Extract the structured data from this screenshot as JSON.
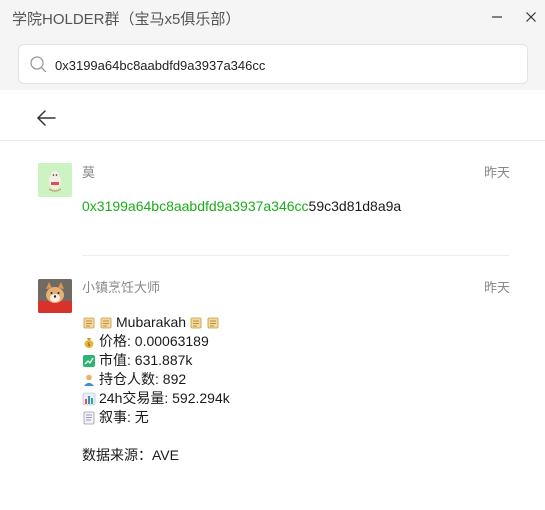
{
  "window": {
    "title": "学院HOLDER群（宝马x5俱乐部）",
    "min_icon": "minimize-icon",
    "close_icon": "close-icon"
  },
  "search": {
    "value": "0x3199a64bc8aabdfd9a3937a346cc",
    "icon": "search-icon"
  },
  "nav": {
    "back_icon": "back-arrow-icon"
  },
  "messages": [
    {
      "sender": "莫",
      "time": "昨天",
      "text_highlight": "0x3199a64bc8aabdfd9a3937a346cc",
      "text_rest": "59c3d81d8a9a",
      "highlight_color": "#1aad19"
    },
    {
      "sender": "小镇烹饪大师",
      "time": "昨天",
      "lines": {
        "name": "Mubarakah",
        "price": "价格: 0.00063189",
        "mcap": "市值: 631.887k",
        "holders": "持仓人数: 892",
        "volume": "24h交易量: 592.294k",
        "narrative": "叙事: 无",
        "source": "数据来源：AVE"
      },
      "icons": [
        "scroll-icon",
        "money-bag-icon",
        "chart-up-icon",
        "person-icon",
        "bar-chart-icon",
        "memo-icon"
      ]
    }
  ]
}
